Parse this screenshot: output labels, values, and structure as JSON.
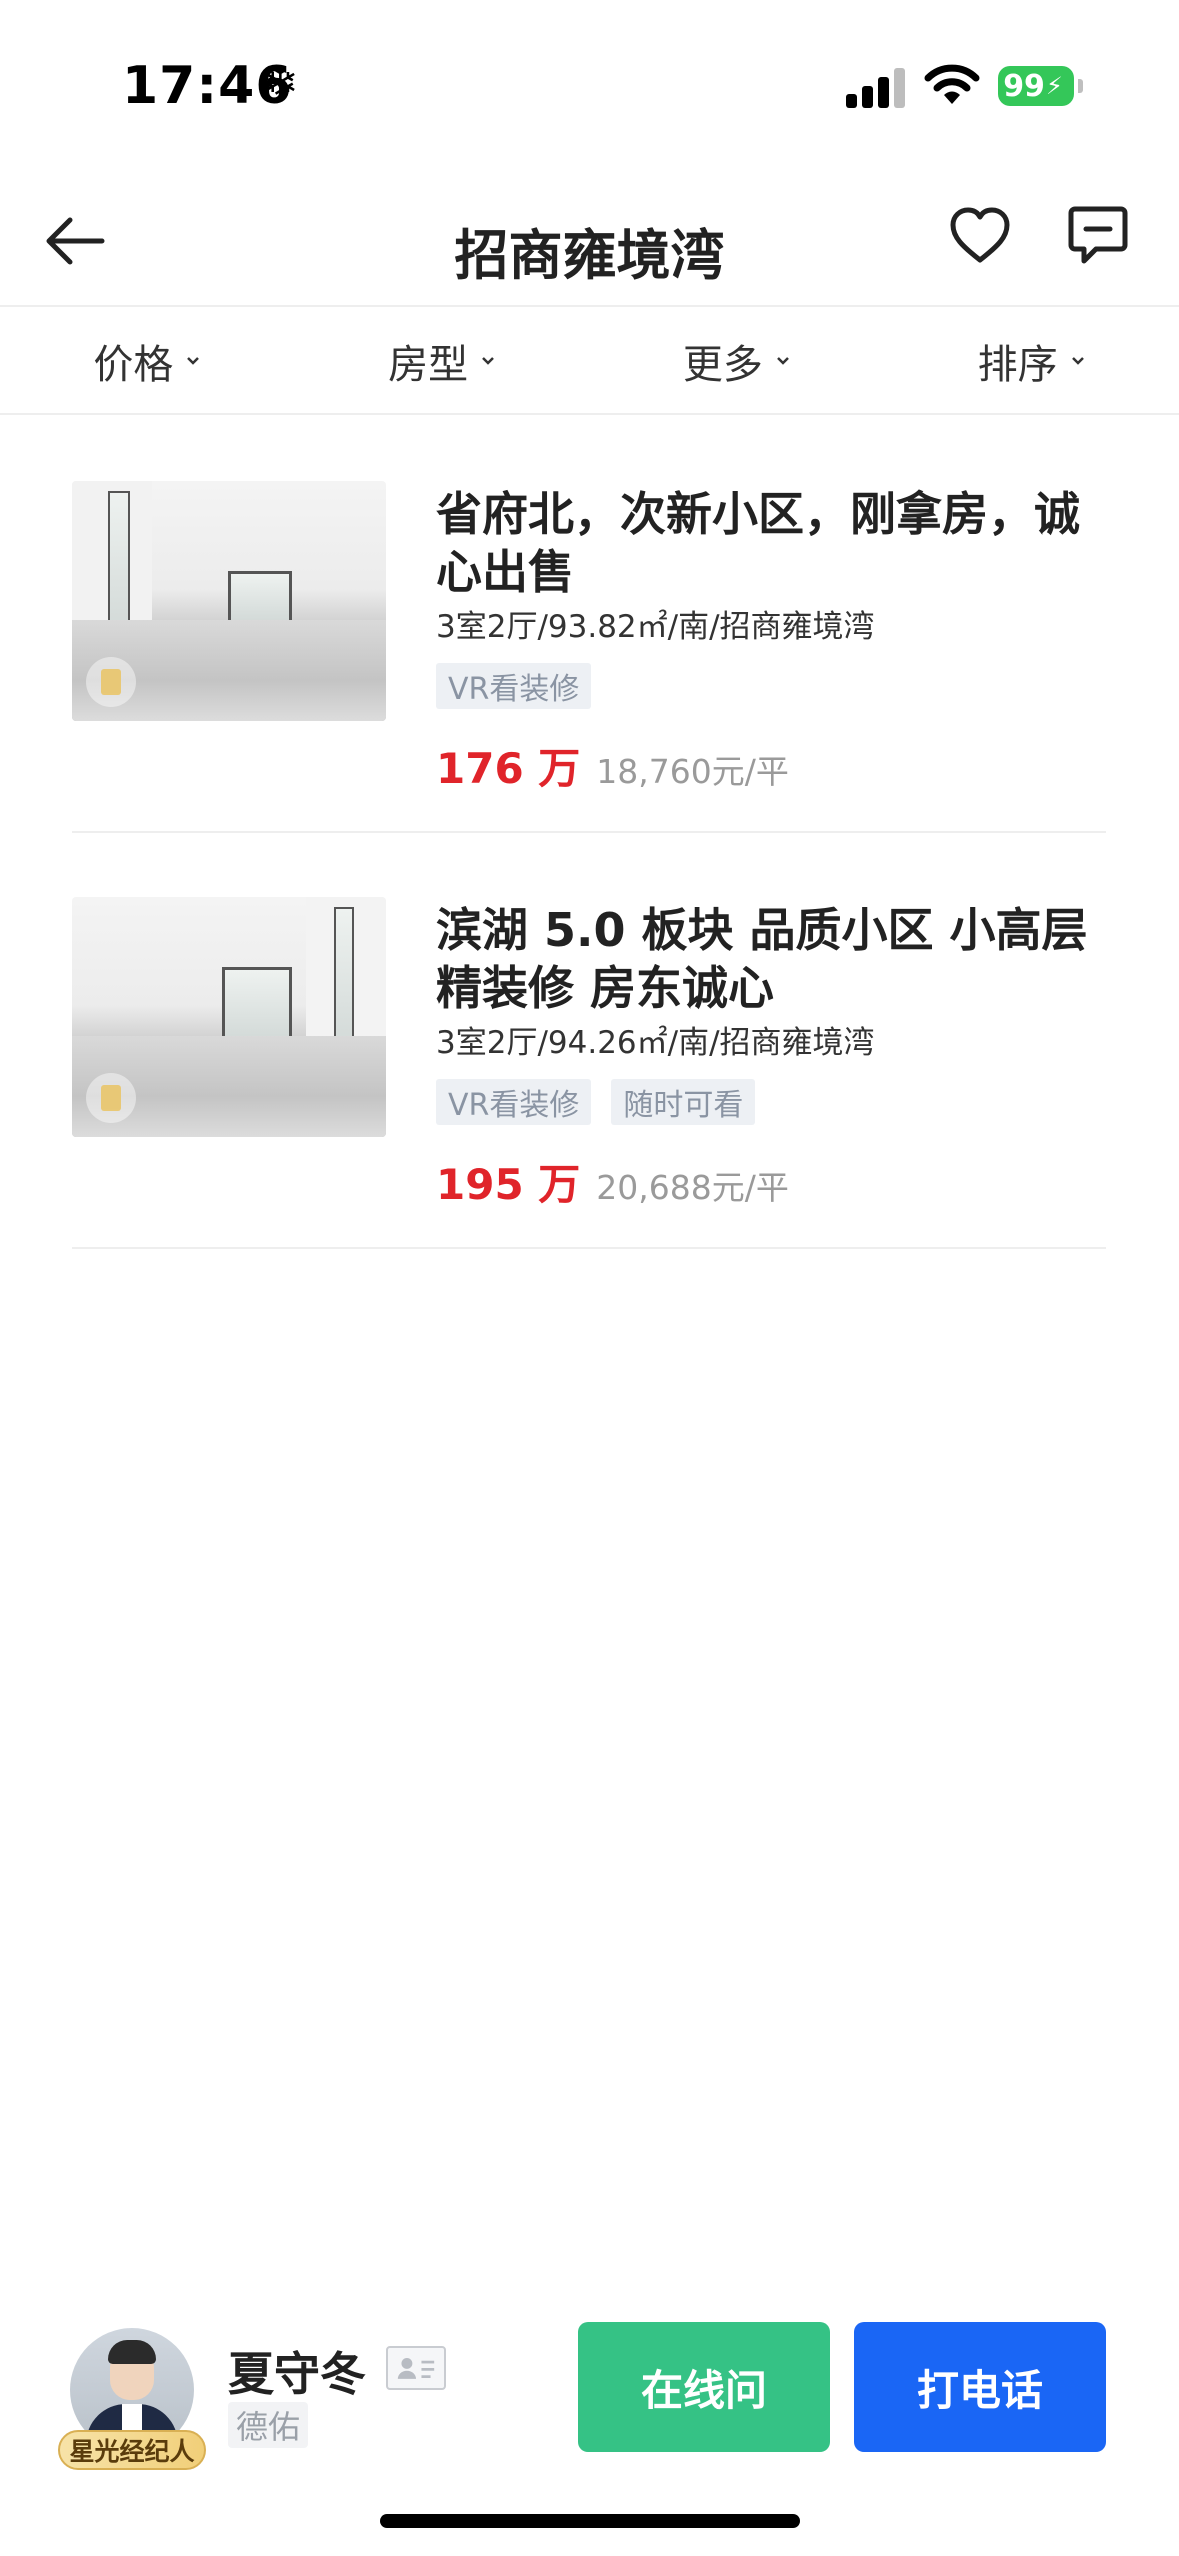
{
  "status_bar": {
    "time": "17:46",
    "snow_icon": "❄",
    "battery": "99"
  },
  "header": {
    "title": "招商雍境湾"
  },
  "filters": [
    {
      "label": "价格"
    },
    {
      "label": "房型"
    },
    {
      "label": "更多"
    },
    {
      "label": "排序"
    }
  ],
  "listings": [
    {
      "title": "省府北，次新小区，刚拿房，诚心出售",
      "info": "3室2厅/93.82㎡/南/招商雍境湾",
      "tags": [
        "VR看装修"
      ],
      "price": "176 万",
      "unit_price": "18,760元/平"
    },
    {
      "title": "滨湖 5.0 板块 品质小区 小高层精装修 房东诚心",
      "info": "3室2厅/94.26㎡/南/招商雍境湾",
      "tags": [
        "VR看装修",
        "随时可看"
      ],
      "price": "195 万",
      "unit_price": "20,688元/平"
    }
  ],
  "agent": {
    "name": "夏守冬",
    "badge": "星光经纪人",
    "company": "德佑",
    "chat_label": "在线问",
    "call_label": "打电话"
  },
  "colors": {
    "price_red": "#e0242a",
    "chat_green": "#35c285",
    "call_blue": "#1a66f5",
    "battery_green": "#34c759"
  }
}
